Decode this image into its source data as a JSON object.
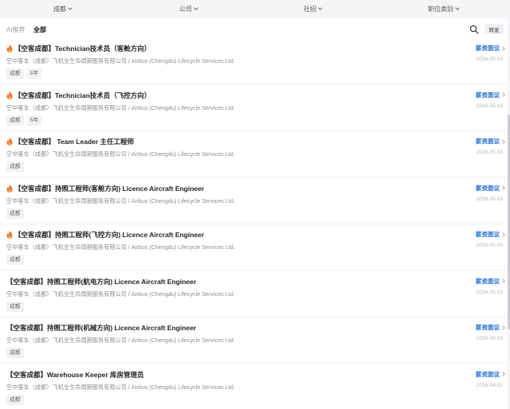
{
  "filters": {
    "city": "成都",
    "company": "公司",
    "recruit_type": "社招",
    "job_category": "职位类别"
  },
  "tabs": {
    "ai": "AI推荐",
    "all": "全部"
  },
  "toolbar": {
    "share_label": "转发"
  },
  "jobs": [
    {
      "hot": true,
      "title": "【空客成都】Technician技术员（客舱方向）",
      "company": "空中客车（成都）飞机全生命周期服务有限公司 / Airbus (Chengdu) Lifecycle Services Ltd.",
      "tags": [
        "成都",
        "5年"
      ],
      "salary": "薪资面议",
      "date": "2026-05-03"
    },
    {
      "hot": true,
      "title": "【空客成都】Technician技术员（飞控方向）",
      "company": "空中客车（成都）飞机全生命周期服务有限公司 / Airbus (Chengdu) Lifecycle Services Ltd.",
      "tags": [
        "成都",
        "5年"
      ],
      "salary": "薪资面议",
      "date": "2026-05-03"
    },
    {
      "hot": true,
      "title": "【空客成都】 Team Leader 主任工程师",
      "company": "空中客车（成都）飞机全生命周期服务有限公司 / Airbus (Chengdu) Lifecycle Services Ltd.",
      "tags": [
        "成都"
      ],
      "salary": "薪资面议",
      "date": "2026-05-03"
    },
    {
      "hot": true,
      "title": "【空客成都】持照工程师(客舱方向) Licence Aircraft Engineer",
      "company": "空中客车（成都）飞机全生命周期服务有限公司 / Airbus (Chengdu) Lifecycle Services Ltd.",
      "tags": [
        "成都"
      ],
      "salary": "薪资面议",
      "date": "2026-05-03"
    },
    {
      "hot": true,
      "title": "【空客成都】持照工程师(飞控方向) Licence Aircraft Engineer",
      "company": "空中客车（成都）飞机全生命周期服务有限公司 / Airbus (Chengdu) Lifecycle Services Ltd.",
      "tags": [
        "成都"
      ],
      "salary": "薪资面议",
      "date": "2026-05-03"
    },
    {
      "hot": false,
      "title": "【空客成都】持照工程师(航电方向) Licence Aircraft Engineer",
      "company": "空中客车（成都）飞机全生命周期服务有限公司 / Airbus (Chengdu) Lifecycle Services Ltd.",
      "tags": [
        "成都"
      ],
      "salary": "薪资面议",
      "date": "2026-05-13"
    },
    {
      "hot": false,
      "title": "【空客成都】持照工程师(机械方向) Licence Aircraft Engineer",
      "company": "空中客车（成都）飞机全生命周期服务有限公司 / Airbus (Chengdu) Lifecycle Services Ltd.",
      "tags": [
        "成都"
      ],
      "salary": "薪资面议",
      "date": "2026-05-03"
    },
    {
      "hot": false,
      "title": "【空客成都】Warehouse Keeper 库房管理员",
      "company": "空中客车（成都）飞机全生命周期服务有限公司 / Airbus (Chengdu) Lifecycle Services Ltd.",
      "tags": [
        "成都"
      ],
      "salary": "薪资面议",
      "date": "2026-04-02"
    }
  ],
  "colors": {
    "accent": "#1e6fd9",
    "hot_icon": "#f26b1d"
  },
  "icons": {
    "search": "search-icon",
    "hot": "fire-icon",
    "filter_arrow": "chevron-down-icon",
    "row_arrow": "chevron-right-icon"
  }
}
